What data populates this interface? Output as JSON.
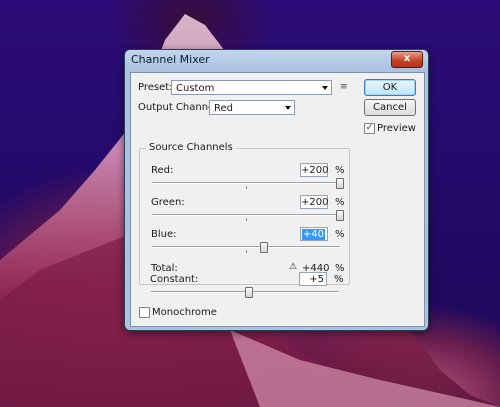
{
  "dialog": {
    "title": "Channel Mixer",
    "close_label": "x",
    "preset_label": "Preset:",
    "preset_value": "Custom",
    "preset_menu_icon": "list-menu-icon",
    "output_channel_label": "Output Channel:",
    "output_channel_value": "Red",
    "ok_label": "OK",
    "cancel_label": "Cancel",
    "preview_label": "Preview",
    "preview_checked": true,
    "source_channels_label": "Source Channels",
    "channels": [
      {
        "label": "Red:",
        "value": "+200",
        "unit": "%",
        "level": 1.0
      },
      {
        "label": "Green:",
        "value": "+200",
        "unit": "%",
        "level": 1.0
      },
      {
        "label": "Blue:",
        "value": "+40",
        "unit": "%",
        "level": 0.6
      }
    ],
    "total_label": "Total:",
    "total_value": "+440",
    "total_unit": "%",
    "constant_label": "Constant:",
    "constant_value": "+5",
    "constant_unit": "%",
    "constant_level": 0.52,
    "monochrome_label": "Monochrome",
    "monochrome_checked": false
  },
  "colors": {
    "background": "#250a6b",
    "titlebar": "#aac3e0",
    "selection": "#3399ff"
  }
}
